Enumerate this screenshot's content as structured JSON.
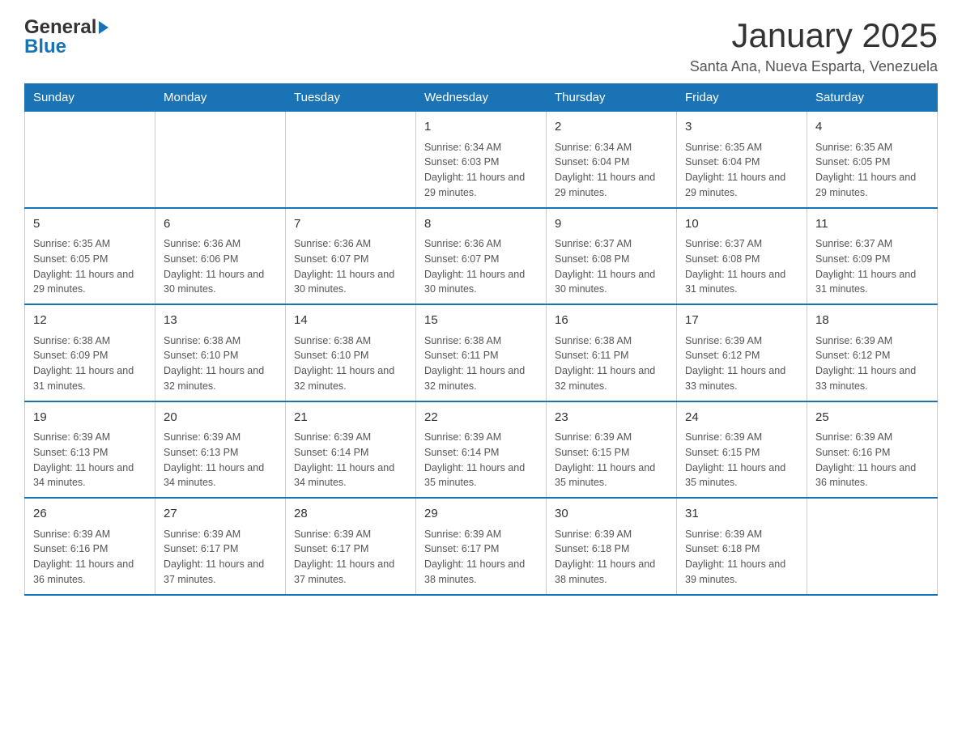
{
  "logo": {
    "general": "General",
    "blue": "Blue"
  },
  "title": "January 2025",
  "subtitle": "Santa Ana, Nueva Esparta, Venezuela",
  "days_of_week": [
    "Sunday",
    "Monday",
    "Tuesday",
    "Wednesday",
    "Thursday",
    "Friday",
    "Saturday"
  ],
  "weeks": [
    [
      {
        "day": "",
        "info": ""
      },
      {
        "day": "",
        "info": ""
      },
      {
        "day": "",
        "info": ""
      },
      {
        "day": "1",
        "info": "Sunrise: 6:34 AM\nSunset: 6:03 PM\nDaylight: 11 hours and 29 minutes."
      },
      {
        "day": "2",
        "info": "Sunrise: 6:34 AM\nSunset: 6:04 PM\nDaylight: 11 hours and 29 minutes."
      },
      {
        "day": "3",
        "info": "Sunrise: 6:35 AM\nSunset: 6:04 PM\nDaylight: 11 hours and 29 minutes."
      },
      {
        "day": "4",
        "info": "Sunrise: 6:35 AM\nSunset: 6:05 PM\nDaylight: 11 hours and 29 minutes."
      }
    ],
    [
      {
        "day": "5",
        "info": "Sunrise: 6:35 AM\nSunset: 6:05 PM\nDaylight: 11 hours and 29 minutes."
      },
      {
        "day": "6",
        "info": "Sunrise: 6:36 AM\nSunset: 6:06 PM\nDaylight: 11 hours and 30 minutes."
      },
      {
        "day": "7",
        "info": "Sunrise: 6:36 AM\nSunset: 6:07 PM\nDaylight: 11 hours and 30 minutes."
      },
      {
        "day": "8",
        "info": "Sunrise: 6:36 AM\nSunset: 6:07 PM\nDaylight: 11 hours and 30 minutes."
      },
      {
        "day": "9",
        "info": "Sunrise: 6:37 AM\nSunset: 6:08 PM\nDaylight: 11 hours and 30 minutes."
      },
      {
        "day": "10",
        "info": "Sunrise: 6:37 AM\nSunset: 6:08 PM\nDaylight: 11 hours and 31 minutes."
      },
      {
        "day": "11",
        "info": "Sunrise: 6:37 AM\nSunset: 6:09 PM\nDaylight: 11 hours and 31 minutes."
      }
    ],
    [
      {
        "day": "12",
        "info": "Sunrise: 6:38 AM\nSunset: 6:09 PM\nDaylight: 11 hours and 31 minutes."
      },
      {
        "day": "13",
        "info": "Sunrise: 6:38 AM\nSunset: 6:10 PM\nDaylight: 11 hours and 32 minutes."
      },
      {
        "day": "14",
        "info": "Sunrise: 6:38 AM\nSunset: 6:10 PM\nDaylight: 11 hours and 32 minutes."
      },
      {
        "day": "15",
        "info": "Sunrise: 6:38 AM\nSunset: 6:11 PM\nDaylight: 11 hours and 32 minutes."
      },
      {
        "day": "16",
        "info": "Sunrise: 6:38 AM\nSunset: 6:11 PM\nDaylight: 11 hours and 32 minutes."
      },
      {
        "day": "17",
        "info": "Sunrise: 6:39 AM\nSunset: 6:12 PM\nDaylight: 11 hours and 33 minutes."
      },
      {
        "day": "18",
        "info": "Sunrise: 6:39 AM\nSunset: 6:12 PM\nDaylight: 11 hours and 33 minutes."
      }
    ],
    [
      {
        "day": "19",
        "info": "Sunrise: 6:39 AM\nSunset: 6:13 PM\nDaylight: 11 hours and 34 minutes."
      },
      {
        "day": "20",
        "info": "Sunrise: 6:39 AM\nSunset: 6:13 PM\nDaylight: 11 hours and 34 minutes."
      },
      {
        "day": "21",
        "info": "Sunrise: 6:39 AM\nSunset: 6:14 PM\nDaylight: 11 hours and 34 minutes."
      },
      {
        "day": "22",
        "info": "Sunrise: 6:39 AM\nSunset: 6:14 PM\nDaylight: 11 hours and 35 minutes."
      },
      {
        "day": "23",
        "info": "Sunrise: 6:39 AM\nSunset: 6:15 PM\nDaylight: 11 hours and 35 minutes."
      },
      {
        "day": "24",
        "info": "Sunrise: 6:39 AM\nSunset: 6:15 PM\nDaylight: 11 hours and 35 minutes."
      },
      {
        "day": "25",
        "info": "Sunrise: 6:39 AM\nSunset: 6:16 PM\nDaylight: 11 hours and 36 minutes."
      }
    ],
    [
      {
        "day": "26",
        "info": "Sunrise: 6:39 AM\nSunset: 6:16 PM\nDaylight: 11 hours and 36 minutes."
      },
      {
        "day": "27",
        "info": "Sunrise: 6:39 AM\nSunset: 6:17 PM\nDaylight: 11 hours and 37 minutes."
      },
      {
        "day": "28",
        "info": "Sunrise: 6:39 AM\nSunset: 6:17 PM\nDaylight: 11 hours and 37 minutes."
      },
      {
        "day": "29",
        "info": "Sunrise: 6:39 AM\nSunset: 6:17 PM\nDaylight: 11 hours and 38 minutes."
      },
      {
        "day": "30",
        "info": "Sunrise: 6:39 AM\nSunset: 6:18 PM\nDaylight: 11 hours and 38 minutes."
      },
      {
        "day": "31",
        "info": "Sunrise: 6:39 AM\nSunset: 6:18 PM\nDaylight: 11 hours and 39 minutes."
      },
      {
        "day": "",
        "info": ""
      }
    ]
  ]
}
